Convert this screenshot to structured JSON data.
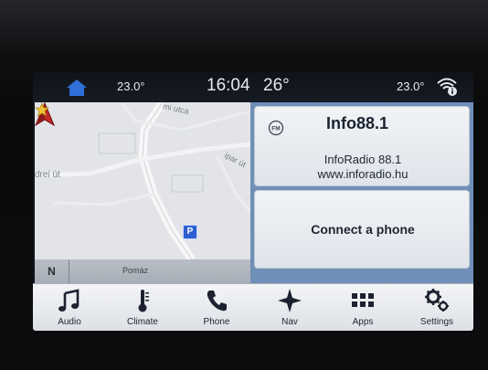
{
  "status_bar": {
    "temp_left": "23.0°",
    "clock": "16:04",
    "outside_temp": "26°",
    "temp_right": "23.0°"
  },
  "map": {
    "street_top": "mi utca",
    "street_left": "drei út",
    "street_right": "ipar út",
    "compass": "N",
    "location_name": "Pomáz",
    "parking_symbol": "P"
  },
  "radio": {
    "station": "Info88.1",
    "line1": "InfoRadio 88.1",
    "line2": "www.inforadio.hu"
  },
  "phone": {
    "connect_label": "Connect a phone"
  },
  "dock": {
    "items": [
      {
        "label": "Audio",
        "icon": "music-note-icon"
      },
      {
        "label": "Climate",
        "icon": "thermometer-icon"
      },
      {
        "label": "Phone",
        "icon": "phone-icon"
      },
      {
        "label": "Nav",
        "icon": "compass-star-icon"
      },
      {
        "label": "Apps",
        "icon": "grid-icon"
      },
      {
        "label": "Settings",
        "icon": "gears-icon"
      }
    ]
  },
  "colors": {
    "accent_blue": "#2f6fd8",
    "panel_background": "#6f8fb8",
    "nav_arrow": "#c62828"
  }
}
